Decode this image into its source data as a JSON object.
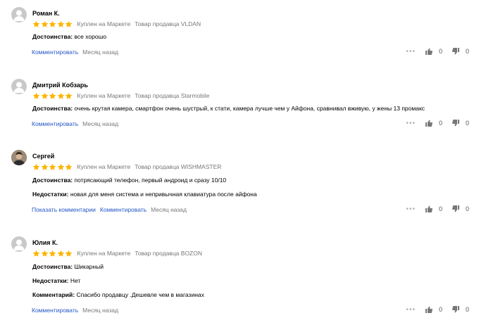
{
  "colors": {
    "accent": "#2456c7",
    "star": "#fcb500",
    "muted": "#777777"
  },
  "reviews": [
    {
      "author": "Роман К.",
      "rating": 5,
      "bought": "Куплен на Маркете",
      "seller": "Товар продавца VLDAN",
      "lines": [
        {
          "label": "Достоинства:",
          "text": "все хорошо"
        }
      ],
      "links": [
        "Комментировать"
      ],
      "date": "Месяц назад",
      "likes": "0",
      "dislikes": "0"
    },
    {
      "author": "Дмитрий Кобзарь",
      "rating": 5,
      "bought": "Куплен на Маркете",
      "seller": "Товар продавца Starmobile",
      "lines": [
        {
          "label": "Достоинства:",
          "text": "очень крутая камера, смартфон очень шустрый, к стати, камера лучше чем у Айфона, сравнивал вживую, у жены 13 промакс"
        }
      ],
      "links": [
        "Комментировать"
      ],
      "date": "Месяц назад",
      "likes": "0",
      "dislikes": "0"
    },
    {
      "author": "Сергей",
      "rating": 5,
      "bought": "Куплен на Маркете",
      "seller": "Товар продавца WISHMASTER",
      "lines": [
        {
          "label": "Достоинства:",
          "text": "потрясающий телефон, первый андроид и сразу 10/10"
        },
        {
          "label": "Недостатки:",
          "text": "новая для меня система и непривычная клавиатура после айфона"
        }
      ],
      "links": [
        "Показать комментарии",
        "Комментировать"
      ],
      "date": "Месяц назад",
      "likes": "0",
      "dislikes": "0"
    },
    {
      "author": "Юлия К.",
      "rating": 5,
      "bought": "Куплен на Маркете",
      "seller": "Товар продавца BOZON",
      "lines": [
        {
          "label": "Достоинства:",
          "text": "Шикарный"
        },
        {
          "label": "Недостатки:",
          "text": "Нет"
        },
        {
          "label": "Комментарий:",
          "text": "Спасибо продавцу .Дешевле чем в магазинах"
        }
      ],
      "links": [
        "Комментировать"
      ],
      "date": "Месяц назад",
      "likes": "0",
      "dislikes": "0"
    }
  ]
}
